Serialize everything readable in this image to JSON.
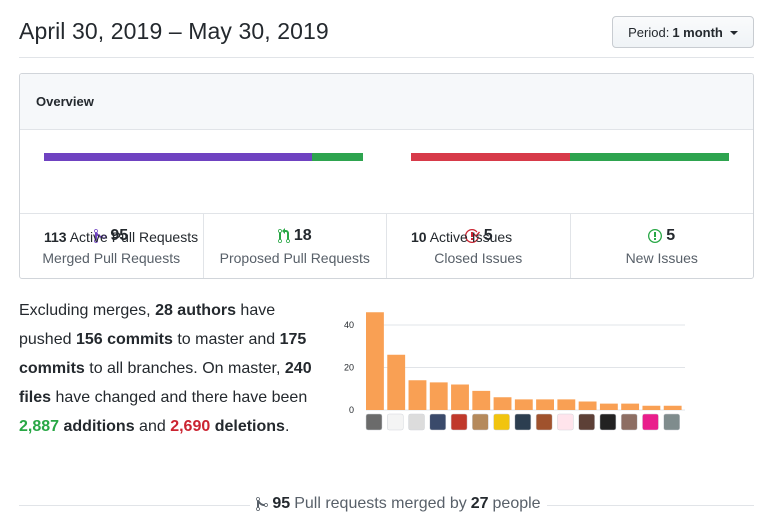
{
  "header": {
    "date_range": "April 30, 2019 – May 30, 2019",
    "period_label": "Period:",
    "period_value": "1 month"
  },
  "overview": {
    "title": "Overview",
    "pull_requests_bar": {
      "merged": 95,
      "open": 18
    },
    "issues_bar": {
      "closed": 5,
      "open": 5
    },
    "active_pull_requests_count": "113",
    "active_pull_requests_label": "Active Pull Requests",
    "active_issues_count": "10",
    "active_issues_label": "Active Issues",
    "stats": [
      {
        "count": "95",
        "label": "Merged Pull Requests",
        "icon": "git-merge-icon",
        "color": "#6f42c1"
      },
      {
        "count": "18",
        "label": "Proposed Pull Requests",
        "icon": "git-pull-request-icon",
        "color": "#28a745"
      },
      {
        "count": "5",
        "label": "Closed Issues",
        "icon": "issue-closed-icon",
        "color": "#cb2431"
      },
      {
        "count": "5",
        "label": "New Issues",
        "icon": "issue-opened-icon",
        "color": "#28a745"
      }
    ]
  },
  "summary": {
    "t1": "Excluding merges, ",
    "authors": "28 authors",
    "t2": " have pushed ",
    "commits_master": "156 commits",
    "t3": " to master and ",
    "commits_all": "175 commits",
    "t4": " to all branches. On master, ",
    "files": "240 files",
    "t5": " have changed and there have been ",
    "additions_num": "2,887",
    "additions_word": " additions",
    "t6": " and ",
    "deletions_num": "2,690",
    "deletions_word": " deletions",
    "t7": "."
  },
  "chart_data": {
    "type": "bar",
    "categories": [
      "1",
      "2",
      "3",
      "4",
      "5",
      "6",
      "7",
      "8",
      "9",
      "10",
      "11",
      "12",
      "13",
      "14",
      "15"
    ],
    "values": [
      46,
      26,
      14,
      13,
      12,
      9,
      6,
      5,
      5,
      5,
      4,
      3,
      3,
      2,
      2
    ],
    "yticks": [
      "0",
      "20",
      "40"
    ],
    "ylim": [
      0,
      48
    ],
    "bar_color": "#f9a054",
    "grid": true
  },
  "footer": {
    "count": "95",
    "text1": "Pull requests merged by",
    "people": "27",
    "text2": "people"
  },
  "colors": {
    "merged": "#6f42c1",
    "green": "#2ea44f",
    "red": "#d73a49"
  }
}
